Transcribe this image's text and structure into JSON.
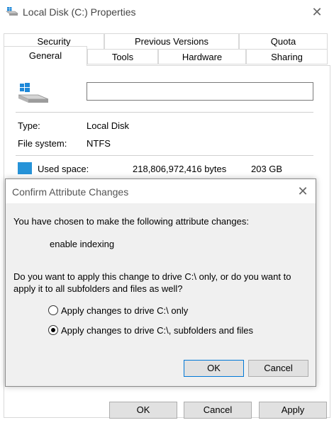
{
  "window": {
    "title": "Local Disk (C:) Properties",
    "close_glyph": "✕"
  },
  "tabs": {
    "row_back": [
      "Security",
      "Previous Versions",
      "Quota"
    ],
    "row_front": [
      "General",
      "Tools",
      "Hardware",
      "Sharing"
    ],
    "active": "General"
  },
  "general": {
    "name_value": "",
    "type_label": "Type:",
    "type_value": "Local Disk",
    "fs_label": "File system:",
    "fs_value": "NTFS",
    "used_label": "Used space:",
    "used_bytes": "218,806,972,416 bytes",
    "used_size": "203 GB",
    "used_color": "#2693d8"
  },
  "dialog": {
    "title": "Confirm Attribute Changes",
    "close_glyph": "✕",
    "intro": "You have chosen to make the following attribute changes:",
    "change": "enable indexing",
    "question_line1": "Do you want to apply this change to drive C:\\ only, or do you want to",
    "question_line2": "apply it to all subfolders and files as well?",
    "option_drive_only": "Apply changes to drive C:\\ only",
    "option_all": "Apply changes to drive C:\\, subfolders and files",
    "selected_option": "all",
    "ok_label": "OK",
    "cancel_label": "Cancel"
  },
  "footer": {
    "ok_label": "OK",
    "cancel_label": "Cancel",
    "apply_label": "Apply"
  }
}
